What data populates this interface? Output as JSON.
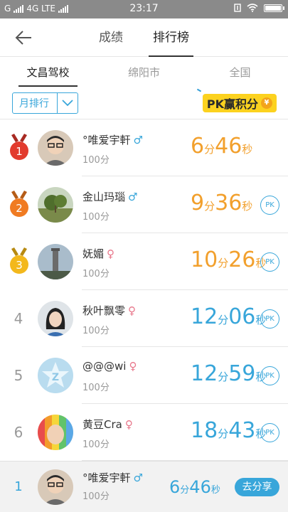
{
  "status_bar": {
    "carrier": "G",
    "network": "4G LTE",
    "time": "23:17"
  },
  "nav": {
    "tabs": [
      {
        "label": "成绩"
      },
      {
        "label": "排行榜"
      }
    ],
    "active_tab": 1
  },
  "scope_tabs": [
    {
      "label": "文昌驾校"
    },
    {
      "label": "绵阳市"
    },
    {
      "label": "全国"
    }
  ],
  "filter": {
    "selected": "月排行",
    "pk_logo": "PK赢积分"
  },
  "ranking": [
    {
      "rank": "1",
      "name": "°唯爱宇軒",
      "gender": "♂",
      "score": "100分",
      "min": "6",
      "min_unit": "分",
      "sec": "46",
      "sec_unit": "秒",
      "color": "orange",
      "pk": ""
    },
    {
      "rank": "2",
      "name": "金山玛瑙",
      "gender": "♂",
      "score": "100分",
      "min": "9",
      "min_unit": "分",
      "sec": "36",
      "sec_unit": "秒",
      "color": "orange",
      "pk": "PK"
    },
    {
      "rank": "3",
      "name": "妩媚",
      "gender": "♀",
      "score": "100分",
      "min": "10",
      "min_unit": "分",
      "sec": "26",
      "sec_unit": "秒",
      "color": "orange",
      "pk": "PK"
    },
    {
      "rank": "4",
      "name": "秋叶飘零",
      "gender": "♀",
      "score": "100分",
      "min": "12",
      "min_unit": "分",
      "sec": "06",
      "sec_unit": "秒",
      "color": "blue",
      "pk": "PK"
    },
    {
      "rank": "5",
      "name": "@@@wi",
      "gender": "♀",
      "score": "100分",
      "min": "12",
      "min_unit": "分",
      "sec": "59",
      "sec_unit": "秒",
      "color": "blue",
      "pk": "PK"
    },
    {
      "rank": "6",
      "name": "黄豆Cra",
      "gender": "♀",
      "score": "100分",
      "min": "18",
      "min_unit": "分",
      "sec": "43",
      "sec_unit": "秒",
      "color": "blue",
      "pk": "PK"
    }
  ],
  "mine": {
    "rank": "1",
    "name": "°唯爱宇軒",
    "gender": "♂",
    "score": "100分",
    "min": "6",
    "min_unit": "分",
    "sec": "46",
    "sec_unit": "秒",
    "share": "去分享"
  },
  "colors": {
    "accent": "#38a6da",
    "orange": "#f2a02d",
    "medal_1": "#e23b2e",
    "medal_2": "#f07b22",
    "medal_3": "#f3b81c",
    "male": "#38a6da",
    "female": "#e8768a"
  }
}
